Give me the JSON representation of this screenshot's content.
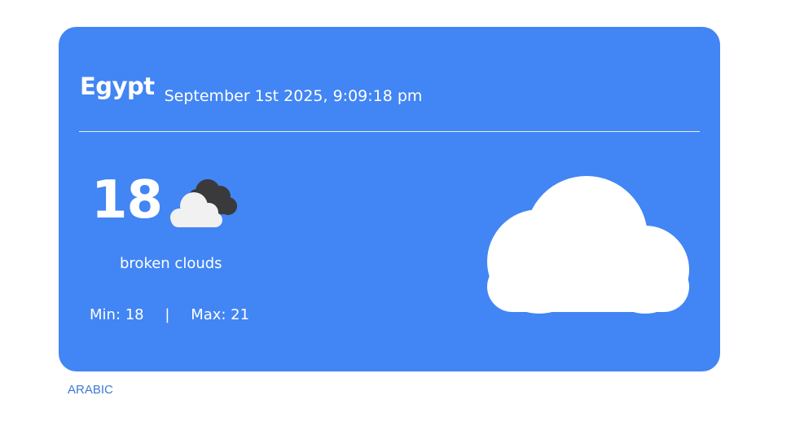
{
  "card": {
    "city": "Egypt",
    "datetime": "September 1st 2025, 9:09:18 pm",
    "temperature": "18",
    "description": "broken clouds",
    "min_label": "Min: 18",
    "separator": "|",
    "max_label": "Max: 21",
    "small_icon": "broken-clouds-icon",
    "big_icon": "cloud-icon"
  },
  "footer": {
    "language_link": "ARABIC"
  },
  "colors": {
    "card_background": "#4285f4",
    "text": "#ffffff",
    "link": "#3b7ad6"
  }
}
